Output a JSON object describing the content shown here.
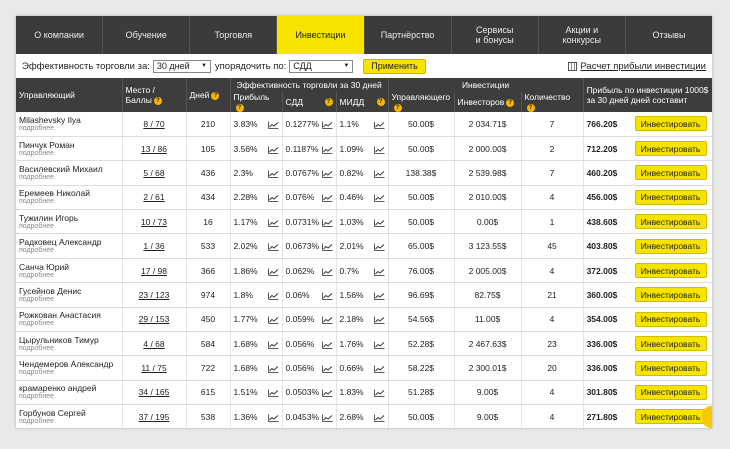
{
  "nav": [
    {
      "label": "О компании",
      "active": false
    },
    {
      "label": "Обучение",
      "active": false
    },
    {
      "label": "Торговля",
      "active": false
    },
    {
      "label": "Инвестиции",
      "active": true
    },
    {
      "label": "Партнёрство",
      "active": false
    },
    {
      "label": "Сервисы\nи бонусы",
      "active": false
    },
    {
      "label": "Акции и\nконкурсы",
      "active": false
    },
    {
      "label": "Отзывы",
      "active": false
    }
  ],
  "filter": {
    "period_label": "Эффективность торговли за:",
    "period_value": "30 дней",
    "order_label": "упорядочить по:",
    "order_value": "СДД",
    "apply_label": "Применить",
    "calc_link": "Расчет прибыли инвестиции"
  },
  "headers": {
    "manager": "Управляющий",
    "place": "Место /\nБаллы",
    "days": "Дней",
    "efficiency_group": "Эффективность торговли за 30 дней",
    "profit": "Прибыль",
    "sdd": "СДД",
    "midd": "МИДД",
    "investments_group": "Инвестиции",
    "inv_manager": "Управляющего",
    "inv_investors": "Инвесторов",
    "inv_count": "Количество",
    "profit_calc": "Прибыль по инвестиции 1000$\nза 30 дней дней составит"
  },
  "more_label": "подробнее",
  "invest_label": "Инвестировать",
  "colors": {
    "accent": "#f7e300",
    "header_bg": "#3d3d3d",
    "nav_bg": "#3b3b3b"
  },
  "rows": [
    {
      "name": "Milashevsky Ilya",
      "rank": "8 / 70",
      "days": "210",
      "profit": "3.83%",
      "sdd": "0.1277%",
      "midd": "1.1%",
      "inv_manager": "50.00$",
      "inv_investors": "2 034.71$",
      "count": "7",
      "result": "766.20$"
    },
    {
      "name": "Пинчук Роман",
      "rank": "13 / 86",
      "days": "105",
      "profit": "3.56%",
      "sdd": "0.1187%",
      "midd": "1.09%",
      "inv_manager": "50.00$",
      "inv_investors": "2 000.00$",
      "count": "2",
      "result": "712.20$"
    },
    {
      "name": "Василевский Михаил",
      "rank": "5 / 68",
      "days": "436",
      "profit": "2.3%",
      "sdd": "0.0767%",
      "midd": "0.82%",
      "inv_manager": "138.38$",
      "inv_investors": "2 539.98$",
      "count": "7",
      "result": "460.20$"
    },
    {
      "name": "Еремеев Николай",
      "rank": "2 / 61",
      "days": "434",
      "profit": "2.28%",
      "sdd": "0.076%",
      "midd": "0.46%",
      "inv_manager": "50.00$",
      "inv_investors": "2 010.00$",
      "count": "4",
      "result": "456.00$"
    },
    {
      "name": "Тужилин Игорь",
      "rank": "10 / 73",
      "days": "16",
      "profit": "1.17%",
      "sdd": "0.0731%",
      "midd": "1.03%",
      "inv_manager": "50.00$",
      "inv_investors": "0.00$",
      "count": "1",
      "result": "438.60$"
    },
    {
      "name": "Радковец Александр",
      "rank": "1 / 36",
      "days": "533",
      "profit": "2.02%",
      "sdd": "0.0673%",
      "midd": "2.01%",
      "inv_manager": "65.00$",
      "inv_investors": "3 123.55$",
      "count": "45",
      "result": "403.80$"
    },
    {
      "name": "Санча Юрий",
      "rank": "17 / 98",
      "days": "366",
      "profit": "1.86%",
      "sdd": "0.062%",
      "midd": "0.7%",
      "inv_manager": "76.00$",
      "inv_investors": "2 005.00$",
      "count": "4",
      "result": "372.00$"
    },
    {
      "name": "Гусейнов Денис",
      "rank": "23 / 123",
      "days": "974",
      "profit": "1.8%",
      "sdd": "0.06%",
      "midd": "1.56%",
      "inv_manager": "96.69$",
      "inv_investors": "82.75$",
      "count": "21",
      "result": "360.00$"
    },
    {
      "name": "Рожкован Анастасия",
      "rank": "29 / 153",
      "days": "450",
      "profit": "1.77%",
      "sdd": "0.059%",
      "midd": "2.18%",
      "inv_manager": "54.56$",
      "inv_investors": "11.00$",
      "count": "4",
      "result": "354.00$"
    },
    {
      "name": "Цырульников Тимур",
      "rank": "4 / 68",
      "days": "584",
      "profit": "1.68%",
      "sdd": "0.056%",
      "midd": "1.76%",
      "inv_manager": "52.28$",
      "inv_investors": "2 467.63$",
      "count": "23",
      "result": "336.00$"
    },
    {
      "name": "Чендемеров Александр",
      "rank": "11 / 75",
      "days": "722",
      "profit": "1.68%",
      "sdd": "0.056%",
      "midd": "0.66%",
      "inv_manager": "58.22$",
      "inv_investors": "2 300.01$",
      "count": "20",
      "result": "336.00$"
    },
    {
      "name": "крамаренко андрей",
      "rank": "34 / 165",
      "days": "615",
      "profit": "1.51%",
      "sdd": "0.0503%",
      "midd": "1.83%",
      "inv_manager": "51.28$",
      "inv_investors": "9.00$",
      "count": "4",
      "result": "301.80$"
    },
    {
      "name": "Горбунов Сергей",
      "rank": "37 / 195",
      "days": "538",
      "profit": "1.36%",
      "sdd": "0.0453%",
      "midd": "2.68%",
      "inv_manager": "50.00$",
      "inv_investors": "9.00$",
      "count": "4",
      "result": "271.80$"
    }
  ]
}
